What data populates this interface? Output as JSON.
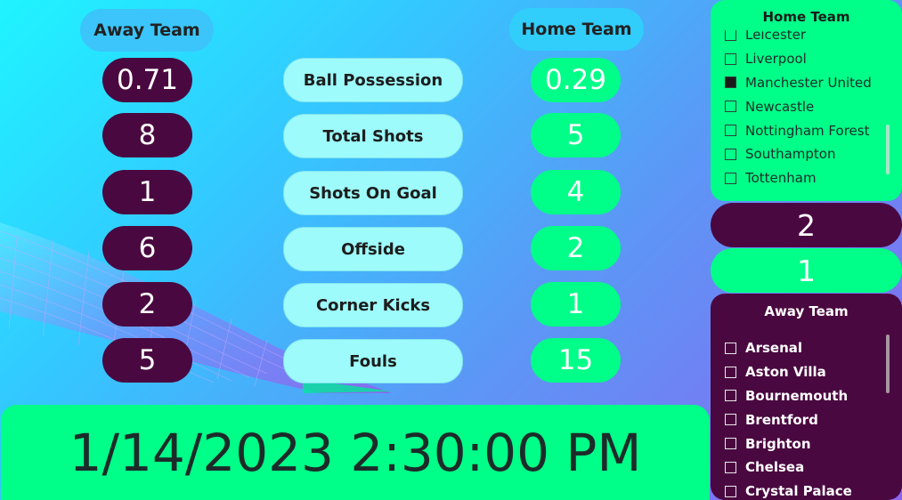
{
  "header": {
    "away_team_label": "Away Team",
    "home_team_label": "Home Team"
  },
  "stats": [
    {
      "label": "Ball Possession",
      "away": "0.71",
      "home": "0.29"
    },
    {
      "label": "Total Shots",
      "away": "8",
      "home": "5"
    },
    {
      "label": "Shots On Goal",
      "away": "1",
      "home": "4"
    },
    {
      "label": "Offside",
      "away": "6",
      "home": "2"
    },
    {
      "label": "Corner Kicks",
      "away": "2",
      "home": "1"
    },
    {
      "label": "Fouls",
      "away": "5",
      "home": "15"
    }
  ],
  "datetime": "1/14/2023 2:30:00 PM",
  "home_panel": {
    "title": "Home Team",
    "items": [
      {
        "label": "Leicester",
        "checked": false
      },
      {
        "label": "Liverpool",
        "checked": false
      },
      {
        "label": "Manchester United",
        "checked": true
      },
      {
        "label": "Newcastle",
        "checked": false
      },
      {
        "label": "Nottingham Forest",
        "checked": false
      },
      {
        "label": "Southampton",
        "checked": false
      },
      {
        "label": "Tottenham",
        "checked": false
      }
    ]
  },
  "scores": {
    "home": "2",
    "away": "1"
  },
  "away_panel": {
    "title": "Away Team",
    "items": [
      {
        "label": "Arsenal",
        "checked": false
      },
      {
        "label": "Aston Villa",
        "checked": false
      },
      {
        "label": "Bournemouth",
        "checked": false
      },
      {
        "label": "Brentford",
        "checked": false
      },
      {
        "label": "Brighton",
        "checked": false
      },
      {
        "label": "Chelsea",
        "checked": false
      },
      {
        "label": "Crystal Palace",
        "checked": false
      }
    ]
  },
  "colors": {
    "away_accent": "#4a0840",
    "home_accent": "#00ff88",
    "label_bg": "#9dfbfb",
    "team_header_bg": "#3bc5fb"
  }
}
